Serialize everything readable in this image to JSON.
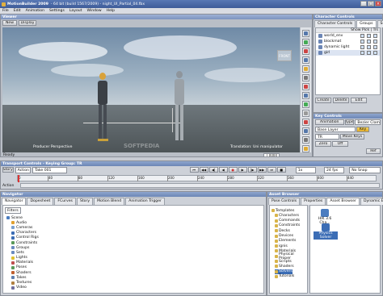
{
  "titlebar": {
    "app": "MotionBuilder 2009",
    "file": "- 64 bit (build 1567/2009) - night_UI_Partial_04.fbx"
  },
  "menu": [
    "File",
    "Edit",
    "Animation",
    "Settings",
    "Layout",
    "Window",
    "Help"
  ],
  "viewer": {
    "title": "Viewer",
    "new_btn": "New",
    "display_btn": "Display",
    "producer_label": "Producer Perspective",
    "translation_label": "Translation: Uni manipulator",
    "watermark": "SOFTPEDIA",
    "status": "Ready",
    "frame_field": "T 0000",
    "front_label": "FRONT"
  },
  "character_controls": {
    "title": "Character Controls",
    "tabs": [
      "Character Controls",
      "Groups",
      "Sets"
    ],
    "header": "Show Pick | Trs",
    "items": [
      "world_env",
      "blockmat",
      "dynamic light",
      "girl"
    ],
    "buttons": [
      "Create",
      "Delete",
      "Edit"
    ]
  },
  "key_controls": {
    "title": "Key Controls",
    "row1": [
      "Animation",
      "Type",
      "Bezier Clamp"
    ],
    "row2": [
      "Base Layer",
      "Key"
    ],
    "row3": [
      "TR",
      "Move Keys"
    ],
    "row4": [
      "Zero",
      "Off"
    ],
    "tail": "Ref"
  },
  "transport": {
    "title": "Transport Controls - Keying Group: TR",
    "story_btn": "Story",
    "action_field": "Action",
    "take_field": "Take 001",
    "fps_field": "24 fps",
    "snap_field": "No Snap",
    "rate_field": "1x",
    "ticks": [
      "0",
      "40",
      "80",
      "120",
      "160",
      "200",
      "240",
      "280",
      "320",
      "360",
      "400",
      "440"
    ],
    "row2_label": "Action"
  },
  "navigator": {
    "title": "Navigator",
    "tabs": [
      "Navigator",
      "Dopesheet",
      "FCurves",
      "Story",
      "Motion Blend",
      "Animation Trigger"
    ],
    "filter": "Filters",
    "tree": [
      "Scene",
      "Audio",
      "Cameras",
      "Characters",
      "Control Rigs",
      "Constraints",
      "Groups",
      "Sets",
      "Lights",
      "Materials",
      "Poses",
      "Shaders",
      "Takes",
      "Textures",
      "Video"
    ]
  },
  "asset_browser": {
    "title": "Asset Browser",
    "tabs": [
      "Pose Controls",
      "Properties",
      "Asset Browser",
      "Dynamic Editor"
    ],
    "tree": [
      "Templates",
      "Characters",
      "Commands",
      "Constraints",
      "Decks",
      "Devices",
      "Elements",
      "ignis",
      "Materials",
      "Physical Proper",
      "Scripts",
      "Shaders",
      "Solvers",
      "Tutorials"
    ],
    "items": [
      "HIK 3.6 Cha...",
      "Physics Solver"
    ]
  },
  "colors": {
    "accent": "#6c86b5",
    "panel": "#c7cbd2",
    "sky": "#8ea3b7",
    "floor": "#5a6266"
  }
}
